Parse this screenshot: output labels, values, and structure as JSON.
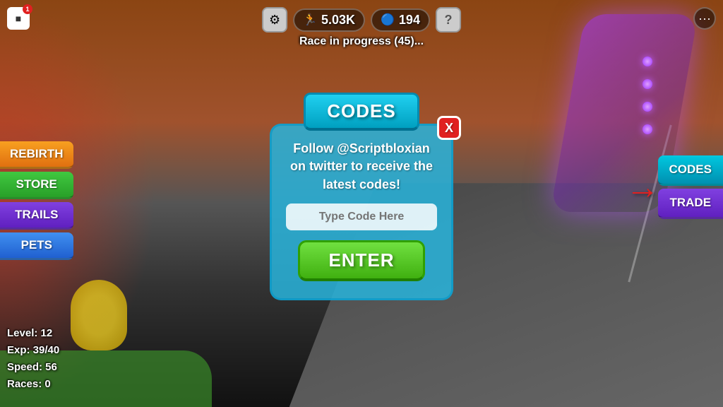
{
  "background": {
    "color": "#5a3010"
  },
  "hud": {
    "steps": "5.03K",
    "gems": "194",
    "race_status": "Race in progress (45)...",
    "gear_icon": "⚙",
    "run_icon": "🏃",
    "gem_icon": "🔵",
    "question_icon": "?",
    "more_icon": "···"
  },
  "left_sidebar": {
    "rebirth_label": "REBIRTH",
    "store_label": "STORE",
    "trails_label": "TRAILS",
    "pets_label": "PETS"
  },
  "stats": {
    "level_label": "Level: 12",
    "exp_label": "Exp: 39/40",
    "speed_label": "Speed: 56",
    "races_label": "Races: 0"
  },
  "right_buttons": {
    "codes_label": "CODES",
    "trade_label": "TRADE"
  },
  "codes_modal": {
    "title": "CODES",
    "close_label": "X",
    "description": "Follow @Scriptbloxian on twitter to receive the latest codes!",
    "input_placeholder": "Type Code Here",
    "enter_label": "ENTER"
  }
}
